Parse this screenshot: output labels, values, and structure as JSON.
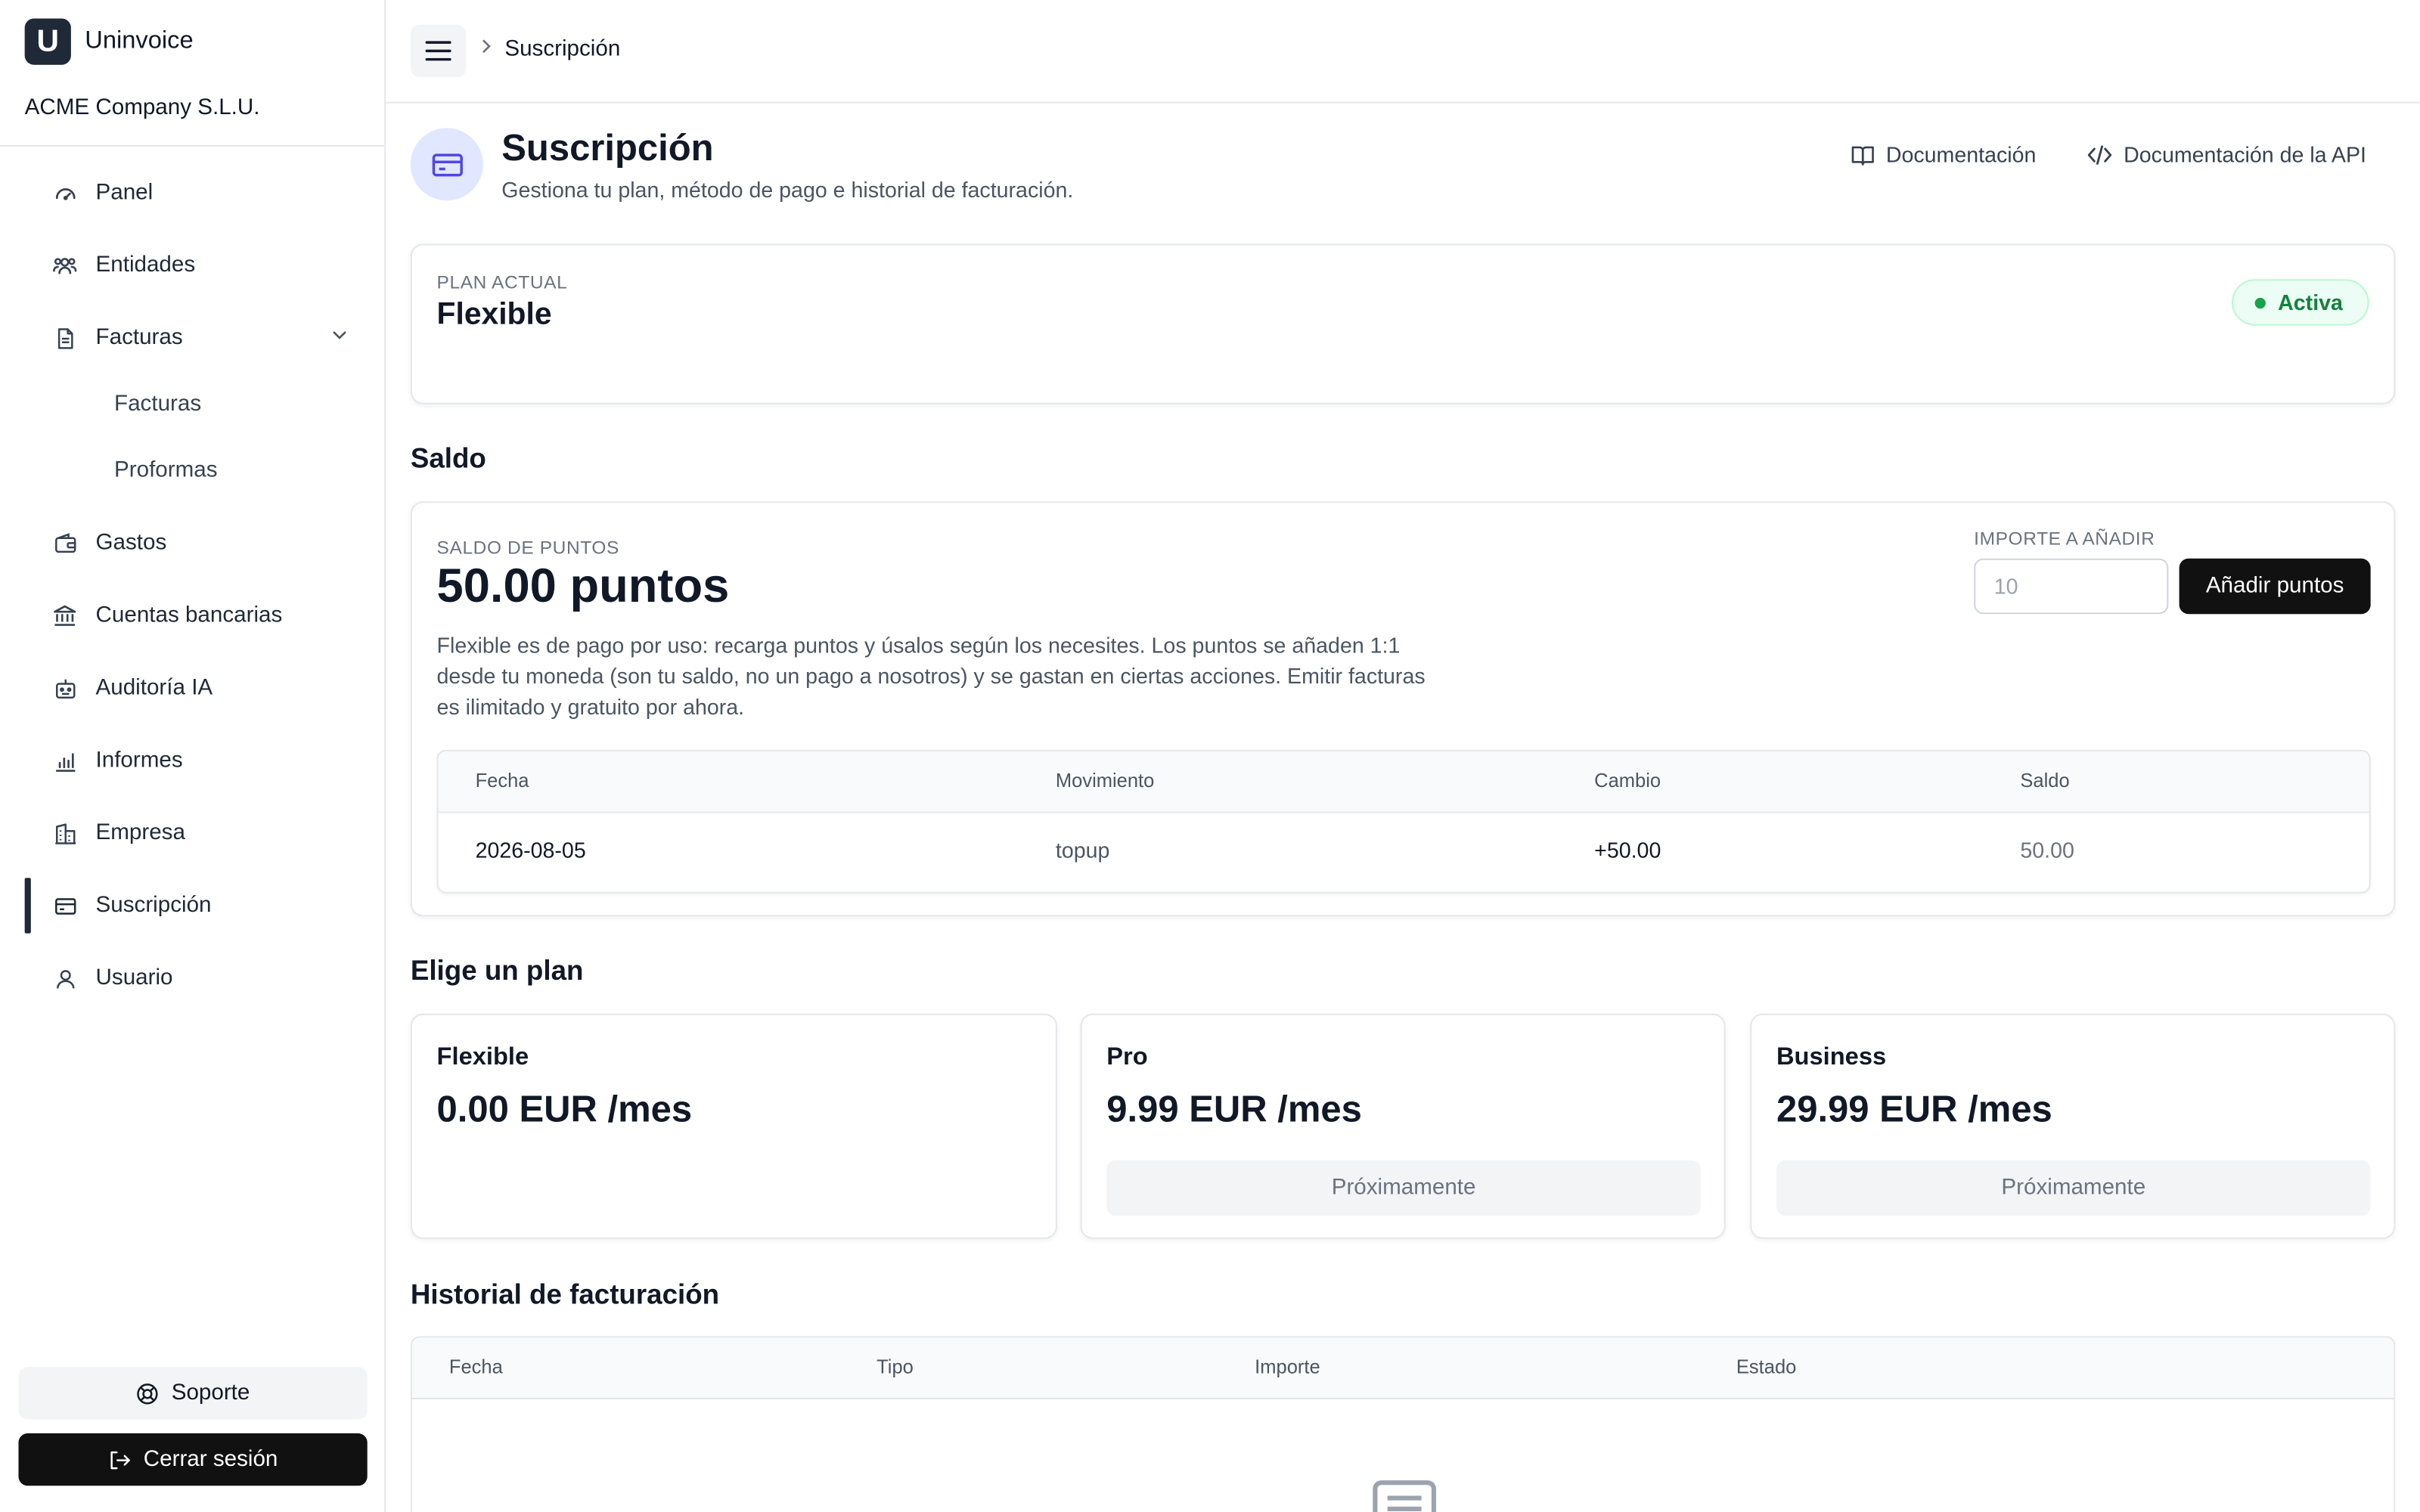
{
  "app": {
    "name": "Uninvoice",
    "logo_letter": "U",
    "company": "ACME Company S.L.U."
  },
  "sidebar": {
    "items": [
      {
        "label": "Panel",
        "icon": "gauge-icon"
      },
      {
        "label": "Entidades",
        "icon": "users-icon"
      },
      {
        "label": "Facturas",
        "icon": "document-icon",
        "expanded": true,
        "children": [
          {
            "label": "Facturas"
          },
          {
            "label": "Proformas"
          }
        ]
      },
      {
        "label": "Gastos",
        "icon": "wallet-icon"
      },
      {
        "label": "Cuentas bancarias",
        "icon": "bank-icon"
      },
      {
        "label": "Auditoría IA",
        "icon": "robot-icon"
      },
      {
        "label": "Informes",
        "icon": "bar-chart-icon"
      },
      {
        "label": "Empresa",
        "icon": "building-icon"
      },
      {
        "label": "Suscripción",
        "icon": "credit-card-icon",
        "active": true
      },
      {
        "label": "Usuario",
        "icon": "user-icon"
      }
    ],
    "support_label": "Soporte",
    "logout_label": "Cerrar sesión"
  },
  "topbar": {
    "breadcrumb": "Suscripción"
  },
  "header": {
    "title": "Suscripción",
    "subtitle": "Gestiona tu plan, método de pago e historial de facturación.",
    "docs_label": "Documentación",
    "api_docs_label": "Documentación de la API"
  },
  "current_plan": {
    "overline": "PLAN ACTUAL",
    "name": "Flexible",
    "status": "Activa",
    "status_color": "#15803d"
  },
  "balance": {
    "section_title": "Saldo",
    "overline": "SALDO DE PUNTOS",
    "value": "50.00 puntos",
    "description": "Flexible es de pago por uso: recarga puntos y úsalos según los necesites. Los puntos se añaden 1:1 desde tu moneda (son tu saldo, no un pago a nosotros) y se gastan en ciertas acciones. Emitir facturas es ilimitado y gratuito por ahora.",
    "amount_label": "IMPORTE A AÑADIR",
    "amount_placeholder": "10",
    "add_button": "Añadir puntos",
    "table": {
      "headers": [
        "Fecha",
        "Movimiento",
        "Cambio",
        "Saldo"
      ],
      "rows": [
        [
          "2026-08-05",
          "topup",
          "+50.00",
          "50.00"
        ]
      ]
    }
  },
  "plans": {
    "section_title": "Elige un plan",
    "items": [
      {
        "name": "Flexible",
        "price": "0.00 EUR /mes",
        "action": ""
      },
      {
        "name": "Pro",
        "price": "9.99 EUR /mes",
        "action": "Próximamente"
      },
      {
        "name": "Business",
        "price": "29.99 EUR /mes",
        "action": "Próximamente"
      }
    ]
  },
  "billing_history": {
    "section_title": "Historial de facturación",
    "headers": [
      "Fecha",
      "Tipo",
      "Importe",
      "Estado"
    ],
    "empty_icon": "empty-list-icon"
  },
  "colors": {
    "accent": "#4f46e5",
    "accent_bg": "#e0e7ff",
    "primary_button": "#111111"
  }
}
